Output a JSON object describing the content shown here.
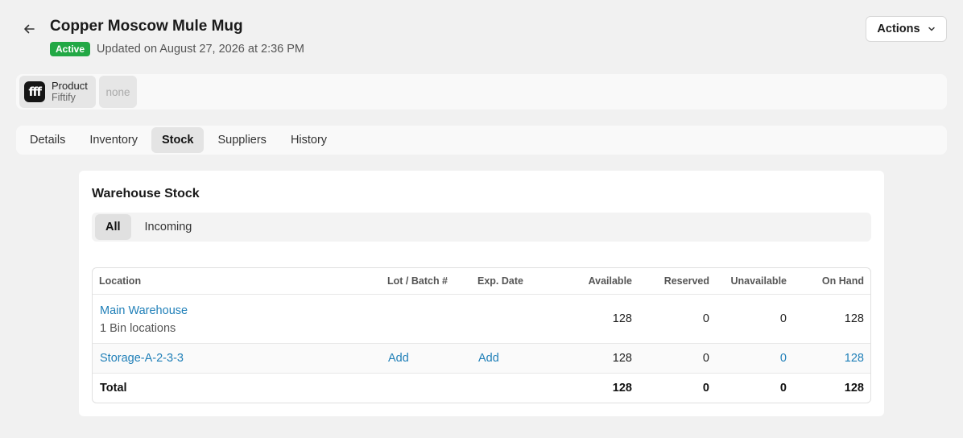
{
  "header": {
    "title": "Copper Moscow Mule Mug",
    "status": "Active",
    "updated": "Updated on August 27, 2026 at 2:36 PM",
    "actions_label": "Actions"
  },
  "channels": {
    "logo_text": "fff",
    "product_label": "Product",
    "product_source": "Fiftify",
    "none_label": "none"
  },
  "tabs": [
    {
      "label": "Details"
    },
    {
      "label": "Inventory"
    },
    {
      "label": "Stock",
      "active": true
    },
    {
      "label": "Suppliers"
    },
    {
      "label": "History"
    }
  ],
  "card": {
    "title": "Warehouse Stock",
    "subtabs": [
      {
        "label": "All",
        "active": true
      },
      {
        "label": "Incoming"
      }
    ]
  },
  "table": {
    "columns": [
      "Location",
      "Lot / Batch #",
      "Exp. Date",
      "Available",
      "Reserved",
      "Unavailable",
      "On Hand"
    ],
    "rows": [
      {
        "location": "Main Warehouse",
        "sub": "1 Bin locations",
        "lot": "",
        "exp": "",
        "available": "128",
        "reserved": "0",
        "unavailable": "0",
        "on_hand": "128"
      },
      {
        "location": "Storage-A-2-3-3",
        "lot": "Add",
        "exp": "Add",
        "available": "128",
        "reserved": "0",
        "unavailable": "0",
        "on_hand": "128"
      }
    ],
    "total": {
      "label": "Total",
      "available": "128",
      "reserved": "0",
      "unavailable": "0",
      "on_hand": "128"
    }
  },
  "colors": {
    "active_badge": "#22a845",
    "link": "#1f7fb8",
    "background": "#f1f1f1"
  }
}
